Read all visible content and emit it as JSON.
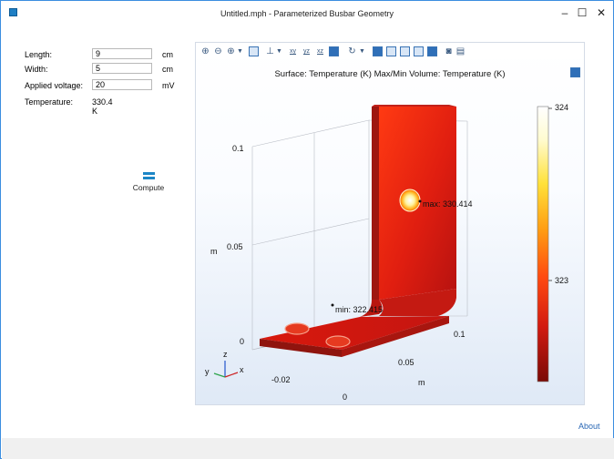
{
  "window": {
    "title": "Untitled.mph - Parameterized Busbar Geometry",
    "minimize_glyph": "–",
    "maximize_glyph": "☐",
    "close_glyph": "✕"
  },
  "form": {
    "length": {
      "label": "Length:",
      "value": "9",
      "unit": "cm"
    },
    "width": {
      "label": "Width:",
      "value": "5",
      "unit": "cm"
    },
    "voltage": {
      "label": "Applied voltage:",
      "value": "20",
      "unit": "mV"
    },
    "temperature": {
      "label": "Temperature:",
      "value": "330.4 K"
    }
  },
  "compute": {
    "label": "Compute",
    "icon": "equals-icon"
  },
  "graphics": {
    "title": "Surface: Temperature (K)  Max/Min Volume: Temperature (K)",
    "toolbar_icons": [
      "zoom-in-icon",
      "zoom-out-icon",
      "zoom-box-icon",
      "dropdown-arrow",
      "zoom-extents-icon",
      "axis-view-icon",
      "dropdown-arrow",
      "view-xy-icon",
      "view-yz-icon",
      "view-xz-icon",
      "scene-light-icon",
      "rotate-icon",
      "dropdown-arrow",
      "select-icon",
      "transparency-icon",
      "wireframe-icon",
      "grid-icon",
      "colors-icon",
      "camera-icon",
      "print-icon"
    ],
    "toolbar_labels": {
      "xy": "xy",
      "yz": "yz",
      "xz": "xz"
    },
    "z_axis": {
      "label": "m",
      "ticks": [
        "0.1",
        "0.05",
        "0"
      ]
    },
    "x_axis": {
      "label": "m",
      "ticks": [
        "-0.02",
        "0"
      ]
    },
    "y_axis": {
      "label": "m",
      "ticks": [
        "0.1",
        "0.05"
      ]
    },
    "max_label": "max: 330.414",
    "min_label": "min: 322.415",
    "triad": {
      "z": "z",
      "y": "y",
      "x": "x"
    },
    "colorbar": {
      "ticks": [
        "324",
        "323"
      ]
    }
  },
  "about": "About",
  "colors": {
    "accent": "#1c86c6",
    "link": "#2a68b5"
  }
}
